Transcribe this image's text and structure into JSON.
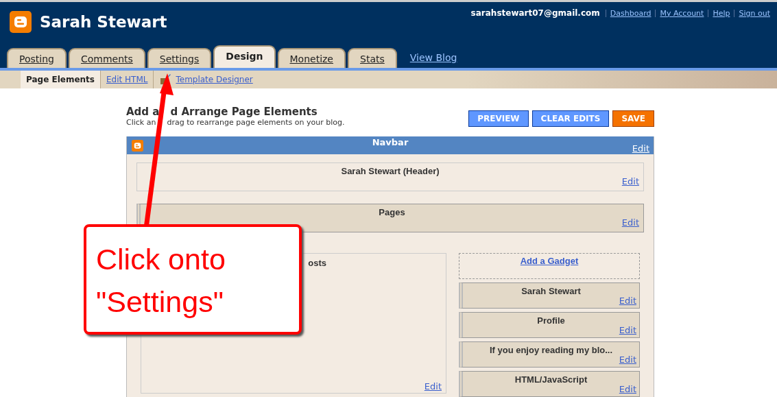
{
  "header": {
    "blog_title": "Sarah Stewart",
    "email": "sarahstewart07@gmail.com",
    "links": [
      "Dashboard",
      "My Account",
      "Help",
      "Sign out"
    ],
    "tabs": [
      {
        "label": "Posting",
        "selected": false
      },
      {
        "label": "Comments",
        "selected": false
      },
      {
        "label": "Settings",
        "selected": false
      },
      {
        "label": "Design",
        "selected": true
      },
      {
        "label": "Monetize",
        "selected": false
      },
      {
        "label": "Stats",
        "selected": false
      }
    ],
    "view_blog": "View Blog"
  },
  "subtabs": [
    {
      "label": "Page Elements",
      "selected": true,
      "kind": "plain"
    },
    {
      "label": "Edit HTML",
      "selected": false,
      "kind": "plain"
    },
    {
      "label": "Template Designer",
      "selected": false,
      "kind": "icon"
    }
  ],
  "editor": {
    "title": [
      "Add a",
      "d Arrange Page Elements"
    ],
    "subtitle": [
      "Click an",
      "drag to rearrange page elements on your blog."
    ],
    "buttons": [
      {
        "label": "PREVIEW",
        "kind": "secondary"
      },
      {
        "label": "CLEAR EDITS",
        "kind": "secondary"
      },
      {
        "label": "SAVE",
        "kind": "primary"
      }
    ]
  },
  "navbar": {
    "title": "Navbar",
    "edit": "Edit"
  },
  "header_gadget": {
    "title": "Sarah Stewart (Header)",
    "edit": "Edit"
  },
  "pages_gadget": {
    "title": "Pages",
    "edit": "Edit"
  },
  "main_gadget": {
    "title": "osts",
    "edit": "Edit"
  },
  "sidebar": {
    "add_gadget": "Add a Gadget",
    "gadgets": [
      {
        "title": "Sarah Stewart",
        "edit": "Edit"
      },
      {
        "title": "Profile",
        "edit": "Edit"
      },
      {
        "title": "If you enjoy reading my blo...",
        "edit": "Edit"
      },
      {
        "title": "HTML/JavaScript",
        "edit": "Edit"
      }
    ]
  },
  "callout": {
    "text": "Click onto \"Settings\""
  }
}
